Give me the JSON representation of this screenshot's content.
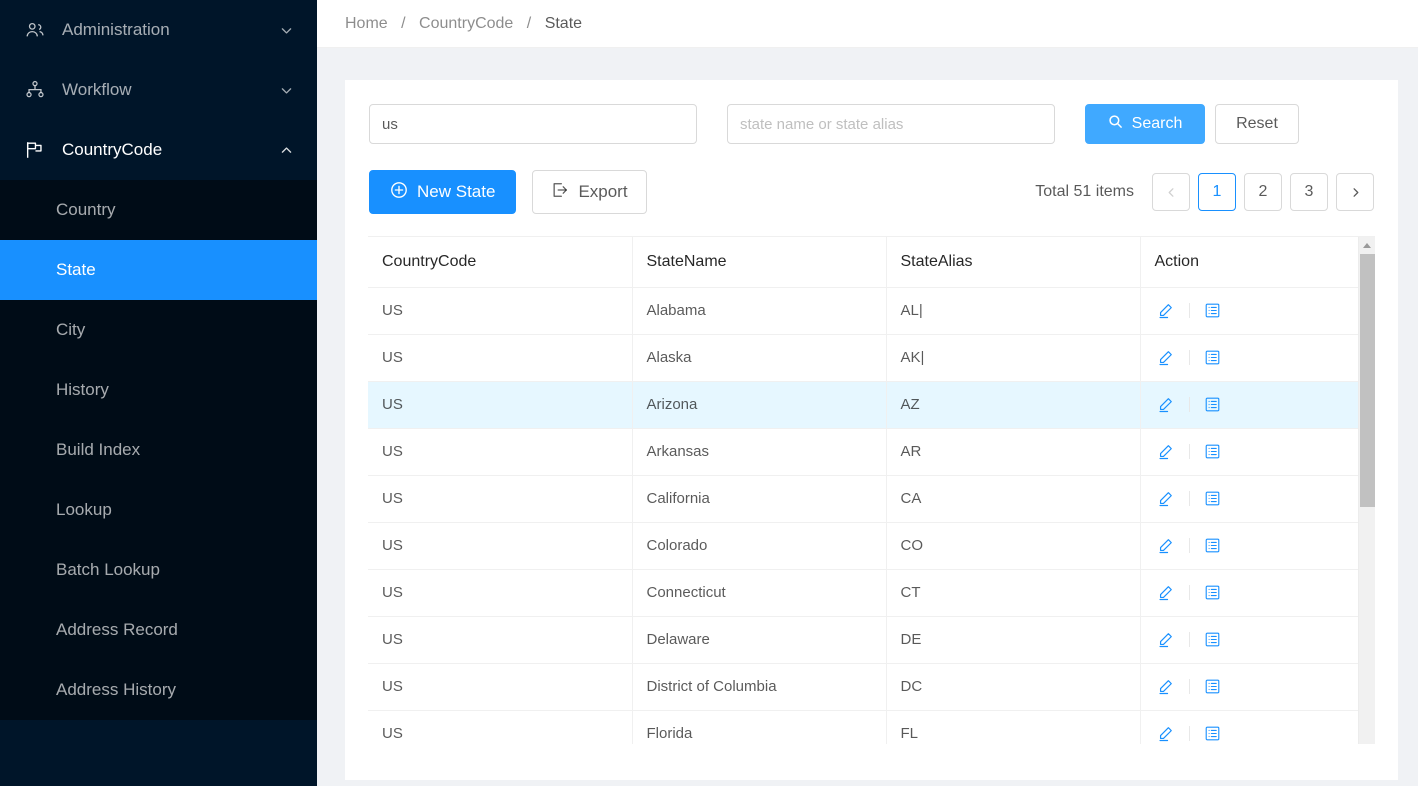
{
  "sidebar": {
    "items": [
      {
        "label": "Administration",
        "icon": "team-icon",
        "arrow": "chevron-down-icon",
        "expanded": false
      },
      {
        "label": "Workflow",
        "icon": "apartment-icon",
        "arrow": "chevron-down-icon",
        "expanded": false
      },
      {
        "label": "CountryCode",
        "icon": "flag-icon",
        "arrow": "chevron-up-icon",
        "expanded": true
      }
    ],
    "submenu": [
      {
        "label": "Country",
        "active": false
      },
      {
        "label": "State",
        "active": true
      },
      {
        "label": "City",
        "active": false
      },
      {
        "label": "History",
        "active": false
      },
      {
        "label": "Build Index",
        "active": false
      },
      {
        "label": "Lookup",
        "active": false
      },
      {
        "label": "Batch Lookup",
        "active": false
      },
      {
        "label": "Address Record",
        "active": false
      },
      {
        "label": "Address History",
        "active": false
      }
    ]
  },
  "breadcrumb": {
    "home": "Home",
    "sep1": "/",
    "section": "CountryCode",
    "sep2": "/",
    "current": "State"
  },
  "filters": {
    "country_value": "us",
    "country_placeholder": "",
    "state_value": "",
    "state_placeholder": "state name or state alias",
    "search_label": "Search",
    "reset_label": "Reset"
  },
  "toolbar": {
    "new_state_label": "New State",
    "export_label": "Export"
  },
  "pagination": {
    "total_label": "Total 51 items",
    "prev": "‹",
    "next": "›",
    "pages": [
      "1",
      "2",
      "3"
    ],
    "current_page": "1"
  },
  "table": {
    "columns": [
      "CountryCode",
      "StateName",
      "StateAlias",
      "Action"
    ],
    "rows": [
      {
        "country_code": "US",
        "state_name": "Alabama",
        "state_alias": "AL|",
        "highlight": false
      },
      {
        "country_code": "US",
        "state_name": "Alaska",
        "state_alias": "AK|",
        "highlight": false
      },
      {
        "country_code": "US",
        "state_name": "Arizona",
        "state_alias": "AZ",
        "highlight": true
      },
      {
        "country_code": "US",
        "state_name": "Arkansas",
        "state_alias": "AR",
        "highlight": false
      },
      {
        "country_code": "US",
        "state_name": "California",
        "state_alias": "CA",
        "highlight": false
      },
      {
        "country_code": "US",
        "state_name": "Colorado",
        "state_alias": "CO",
        "highlight": false
      },
      {
        "country_code": "US",
        "state_name": "Connecticut",
        "state_alias": "CT",
        "highlight": false
      },
      {
        "country_code": "US",
        "state_name": "Delaware",
        "state_alias": "DE",
        "highlight": false
      },
      {
        "country_code": "US",
        "state_name": "District of Columbia",
        "state_alias": "DC",
        "highlight": false
      },
      {
        "country_code": "US",
        "state_name": "Florida",
        "state_alias": "FL",
        "highlight": false
      }
    ],
    "row_actions": [
      {
        "name": "edit-icon",
        "title": "Edit"
      },
      {
        "name": "detail-list-icon",
        "title": "Detail"
      }
    ]
  },
  "colors": {
    "primary": "#1890ff",
    "primary_light": "#40a9ff",
    "sidebar_bg": "#001529",
    "submenu_bg": "#000c17",
    "row_highlight": "#e6f7ff",
    "page_bg": "#f0f2f5"
  }
}
